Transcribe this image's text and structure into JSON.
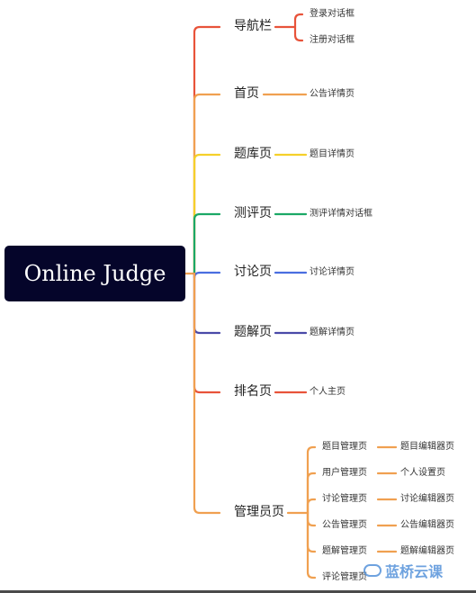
{
  "root": {
    "label": "Online Judge"
  },
  "branches": [
    {
      "label": "导航栏",
      "color": "#e8533a",
      "children": [
        {
          "label": "登录对话框"
        },
        {
          "label": "注册对话框"
        }
      ]
    },
    {
      "label": "首页",
      "color": "#f0a050",
      "children": [
        {
          "label": "公告详情页"
        }
      ]
    },
    {
      "label": "题库页",
      "color": "#f5d02a",
      "children": [
        {
          "label": "题目详情页"
        }
      ]
    },
    {
      "label": "测评页",
      "color": "#1ba866",
      "children": [
        {
          "label": "测评详情对话框"
        }
      ]
    },
    {
      "label": "讨论页",
      "color": "#4a6ee0",
      "children": [
        {
          "label": "讨论详情页"
        }
      ]
    },
    {
      "label": "题解页",
      "color": "#4a4aa8",
      "children": [
        {
          "label": "题解详情页"
        }
      ]
    },
    {
      "label": "排名页",
      "color": "#e8533a",
      "children": [
        {
          "label": "个人主页"
        }
      ]
    },
    {
      "label": "管理员页",
      "color": "#f0a050",
      "children": [
        {
          "label": "题目管理页",
          "children": [
            {
              "label": "题目编辑器页"
            }
          ]
        },
        {
          "label": "用户管理页",
          "children": [
            {
              "label": "个人设置页"
            }
          ]
        },
        {
          "label": "讨论管理页",
          "children": [
            {
              "label": "讨论编辑器页"
            }
          ]
        },
        {
          "label": "公告管理页",
          "children": [
            {
              "label": "公告编辑器页"
            }
          ]
        },
        {
          "label": "题解管理页",
          "children": [
            {
              "label": "题解编辑器页"
            }
          ]
        },
        {
          "label": "评论管理页"
        }
      ]
    }
  ],
  "watermark": {
    "text": "蓝桥云课",
    "icon": "cloud-logo-icon"
  }
}
